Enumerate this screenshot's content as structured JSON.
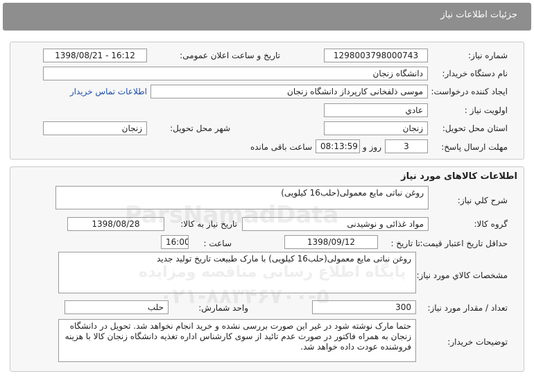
{
  "header": {
    "title": "جزئیات اطلاعات نیاز"
  },
  "info": {
    "need_number_label": "شماره نیاز:",
    "need_number": "1298003798000743",
    "announce_label": "تاریخ و ساعت اعلان عمومی:",
    "announce_value": "1398/08/21 - 16:12",
    "buyer_org_label": "نام دستگاه خریدار:",
    "buyer_org": "دانشگاه زنجان",
    "creator_label": "ایجاد کننده درخواست:",
    "creator": "موسی ذلفخانی کارپرداز دانشگاه زنجان",
    "contact_link": "اطلاعات تماس خریدار",
    "priority_label": "اولویت نیاز :",
    "priority": "عادي",
    "province_label": "استان محل تحویل:",
    "province": "زنجان",
    "city_label": "شهر محل تحویل:",
    "city": "زنجان",
    "deadline_label": "مهلت ارسال پاسخ:",
    "deadline_days": "3",
    "deadline_days_unit": "روز و",
    "deadline_time": "08:13:59",
    "deadline_remaining": "ساعت باقی مانده"
  },
  "goods": {
    "section_title": "اطلاعات کالاهای مورد نیاز",
    "desc_label": "شرح کلي نیاز:",
    "desc": "روغن نباتی مایع معمولی(حلب16 کیلویی)",
    "group_label": "گروه کالا:",
    "group": "مواد غذائی و نوشیدنی",
    "need_date_label": "تاریخ نیاز به کالا:",
    "need_date": "1398/08/28",
    "validity_label": "حداقل تاریخ اعتبار قیمت:",
    "until_label": "تا تاریخ :",
    "validity_date": "1398/09/12",
    "time_label": "ساعت :",
    "validity_time": "16:00",
    "spec_label": "مشخصات کالاي مورد نیاز:",
    "spec": "روغن نباتی مایع معمولی(حلب16 کیلویی) با مارک طبیعت تاریخ تولید جدید",
    "qty_label": "تعداد / مقدار مورد نیاز:",
    "qty": "300",
    "unit_label": "واحد شمارش:",
    "unit": "حلب",
    "notes_label": "توضیحات خریدار:",
    "notes": "حتما مارک نوشته شود در غیر این صورت بررسی نشده و خرید انجام نخواهد شد. تحویل در دانشگاه زنجان  به همراه فاکتور در صورت عدم تائید از سوی کارشناس اداره تغذیه دانشگاه زنجان کالا با هزینه فروشنده عودت داده خواهد شد."
  },
  "watermark": {
    "brand": "ParsNamadData",
    "line1": "پایگاه اطلاع رسانی مناقصه ومزایده",
    "phone": "۰۲۱-۸۸۳۴۶۷۰۰-۵"
  }
}
